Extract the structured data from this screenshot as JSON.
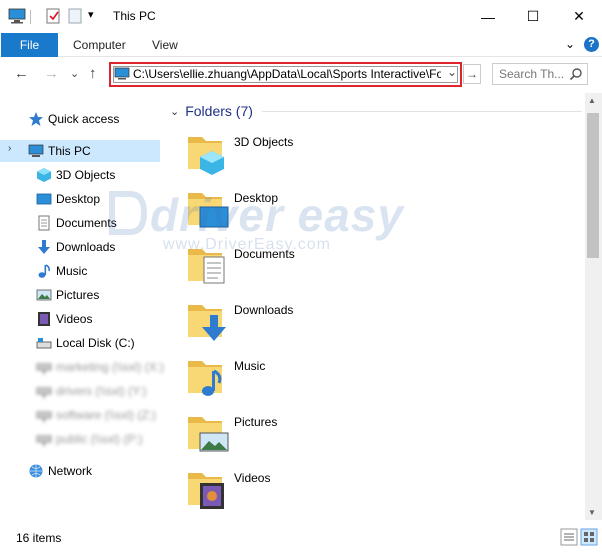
{
  "window": {
    "title": "This PC",
    "minimize": "—",
    "maximize": "☐",
    "close": "✕"
  },
  "ribbon": {
    "tabs": [
      "File",
      "Computer",
      "View"
    ],
    "expand": "⌄",
    "help": "?"
  },
  "address": {
    "path": "C:\\Users\\ellie.zhuang\\AppData\\Local\\Sports Interactive\\Fo",
    "dropdown": "⌄",
    "go": "→",
    "search_placeholder": "Search Th..."
  },
  "nav": {
    "back": "←",
    "forward": "→",
    "recent": "⌄",
    "up": "↑"
  },
  "sidebar": {
    "items": [
      {
        "label": "Quick access",
        "icon": "star-icon"
      },
      {
        "label": "This PC",
        "icon": "computer-icon",
        "selected": true
      },
      {
        "label": "3D Objects",
        "icon": "cube-icon"
      },
      {
        "label": "Desktop",
        "icon": "desktop-icon"
      },
      {
        "label": "Documents",
        "icon": "document-icon"
      },
      {
        "label": "Downloads",
        "icon": "download-icon"
      },
      {
        "label": "Music",
        "icon": "music-icon"
      },
      {
        "label": "Pictures",
        "icon": "picture-icon"
      },
      {
        "label": "Videos",
        "icon": "video-icon"
      },
      {
        "label": "Local Disk (C:)",
        "icon": "disk-icon"
      },
      {
        "label": "marketing (\\\\sxl) (X:)",
        "icon": "network-drive-icon",
        "blurred": true
      },
      {
        "label": "drivers (\\\\sxl) (Y:)",
        "icon": "network-drive-icon",
        "blurred": true
      },
      {
        "label": "software (\\\\sxl) (Z:)",
        "icon": "network-drive-icon",
        "blurred": true
      },
      {
        "label": "public (\\\\sxl) (P:)",
        "icon": "network-drive-icon",
        "blurred": true
      },
      {
        "label": "Network",
        "icon": "network-icon"
      }
    ]
  },
  "content": {
    "group_title": "Folders (7)",
    "folders": [
      {
        "label": "3D Objects",
        "icon": "cube-icon"
      },
      {
        "label": "Desktop",
        "icon": "desktop-icon"
      },
      {
        "label": "Documents",
        "icon": "document-icon"
      },
      {
        "label": "Downloads",
        "icon": "download-icon"
      },
      {
        "label": "Music",
        "icon": "music-icon"
      },
      {
        "label": "Pictures",
        "icon": "picture-icon"
      },
      {
        "label": "Videos",
        "icon": "video-icon"
      }
    ]
  },
  "watermark": {
    "logo": "driver easy",
    "url": "www.DriverEasy.com"
  },
  "status": {
    "items": "16 items"
  },
  "colors": {
    "file_tab": "#1979ca",
    "selection": "#cce8ff",
    "highlight_box": "#e0242b",
    "folder_yellow": "#f8d775",
    "group_title": "#1e3287"
  }
}
